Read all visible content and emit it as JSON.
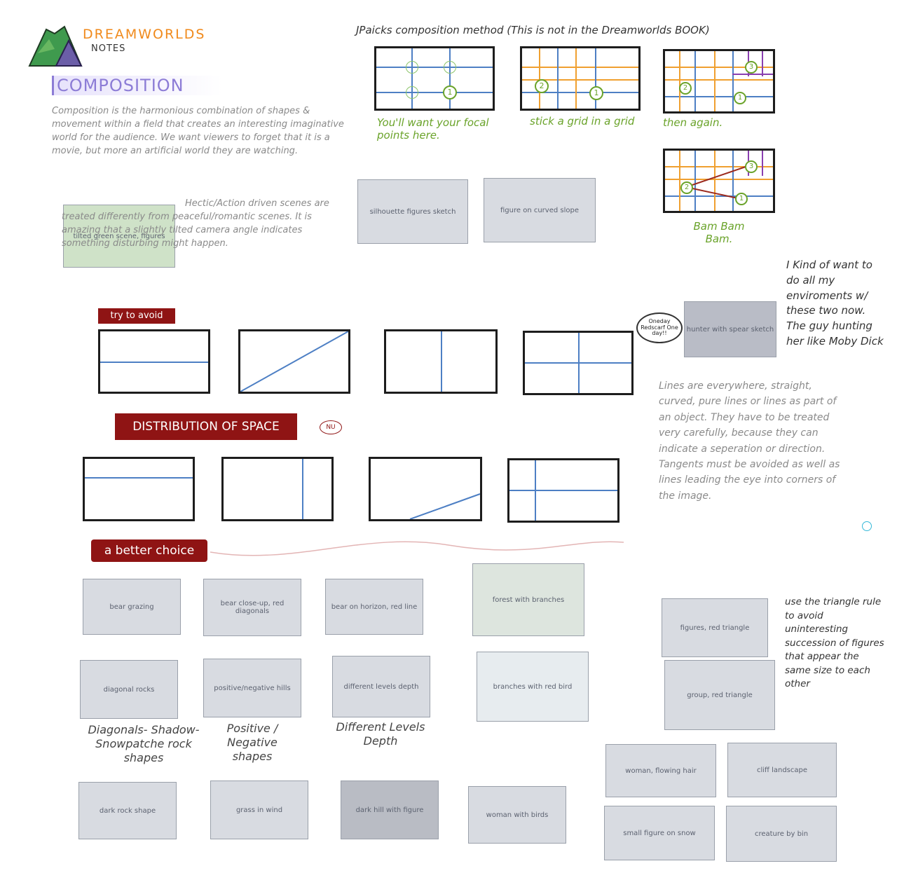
{
  "header": {
    "title": "DREAMWORLDS",
    "subtitle": "NOTES",
    "heading": "COMPOSITION"
  },
  "intro_text": "Composition is the harmonious combination of shapes & movement within a field that creates an interesting imaginative world for the audience. We want viewers to forget that it is a movie, but more an artificial world they are watching.",
  "hectic_text": "Hectic/Action driven scenes are treated differently from peaceful/romantic scenes. It is amazing that a slightly tilted camera angle indicates something disturbing might happen.",
  "jpaicks": {
    "title": "JPaicks composition method (This is not in the Dreamworlds BOOK)",
    "caption_1": "You'll want your focal points here.",
    "caption_2": "stick a grid in a grid",
    "caption_3": "then again.",
    "caption_4": "Bam Bam Bam.",
    "labels": [
      "1",
      "2",
      "3"
    ]
  },
  "avoid": {
    "label": "try to avoid",
    "distribution": "DISTRIBUTION OF SPACE",
    "nu": "NU"
  },
  "better": {
    "label": "a better choice"
  },
  "speech_bubble": "Oneday Redscarf One day!!",
  "right_note": "I Kind of want to do all my enviroments w/ these two now. The guy hunting her like Moby Dick",
  "lines_note": "Lines are everywhere, straight, curved, pure lines or lines as part of an object. They have to be treated very carefully, because they can indicate a seperation or direction. Tangents must be avoided as well as lines leading the eye into corners of the image.",
  "triangle_note": "use the triangle rule to avoid uninteresting succession of figures that appear the same size to each other",
  "captions": {
    "diagonals": "Diagonals- Shadow- Snowpatche rock shapes",
    "positive": "Positive / Negative shapes",
    "levels": "Different Levels Depth"
  },
  "colors": {
    "accent_red": "#8f1414",
    "grid_blue": "#4d7fc4",
    "grid_orange": "#f0a030",
    "grid_purple": "#8a3fb0",
    "green": "#6aa32a",
    "title_orange": "#f08a1c"
  }
}
